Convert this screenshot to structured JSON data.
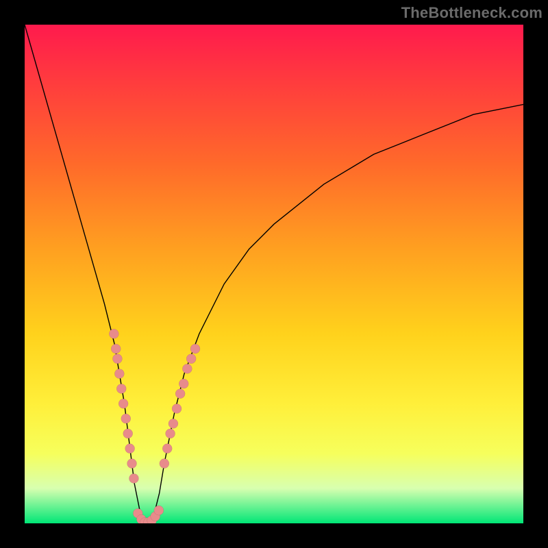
{
  "watermark": "TheBottleneck.com",
  "colors": {
    "background": "#000000",
    "gradient_top": "#ff1a4d",
    "gradient_bottom": "#00e676",
    "curve": "#000000",
    "dot": "#e88b8b"
  },
  "chart_data": {
    "type": "line",
    "title": "",
    "xlabel": "",
    "ylabel": "",
    "xlim": [
      0,
      100
    ],
    "ylim": [
      0,
      100
    ],
    "series": [
      {
        "name": "bottleneck-curve",
        "x": [
          0,
          2,
          4,
          6,
          8,
          10,
          12,
          14,
          16,
          18,
          20,
          21,
          22,
          23,
          24,
          25,
          26,
          27,
          28,
          30,
          32,
          35,
          40,
          45,
          50,
          55,
          60,
          65,
          70,
          75,
          80,
          85,
          90,
          95,
          100
        ],
        "y": [
          100,
          93,
          86,
          79,
          72,
          65,
          58,
          51,
          44,
          36,
          24,
          16,
          8,
          3,
          0,
          0,
          2,
          6,
          12,
          22,
          30,
          38,
          48,
          55,
          60,
          64,
          68,
          71,
          74,
          76,
          78,
          80,
          82,
          83,
          84
        ]
      }
    ],
    "points": [
      {
        "name": "left-dots",
        "x": [
          17.9,
          18.3,
          18.6,
          19.0,
          19.4,
          19.8,
          20.3,
          20.7,
          21.1,
          21.5,
          21.9
        ],
        "y": [
          38,
          35,
          33,
          30,
          27,
          24,
          21,
          18,
          15,
          12,
          9
        ]
      },
      {
        "name": "right-dots",
        "x": [
          28.0,
          28.6,
          29.2,
          29.8,
          30.5,
          31.2,
          31.9,
          32.6,
          33.4,
          34.2
        ],
        "y": [
          12,
          15,
          18,
          20,
          23,
          26,
          28,
          31,
          33,
          35
        ]
      },
      {
        "name": "bottom-dots",
        "x": [
          22.7,
          23.4,
          24.1,
          24.8,
          25.5,
          26.2,
          26.9
        ],
        "y": [
          2.0,
          0.8,
          0.2,
          0.2,
          0.6,
          1.4,
          2.6
        ]
      }
    ],
    "legend": [],
    "grid": false
  }
}
